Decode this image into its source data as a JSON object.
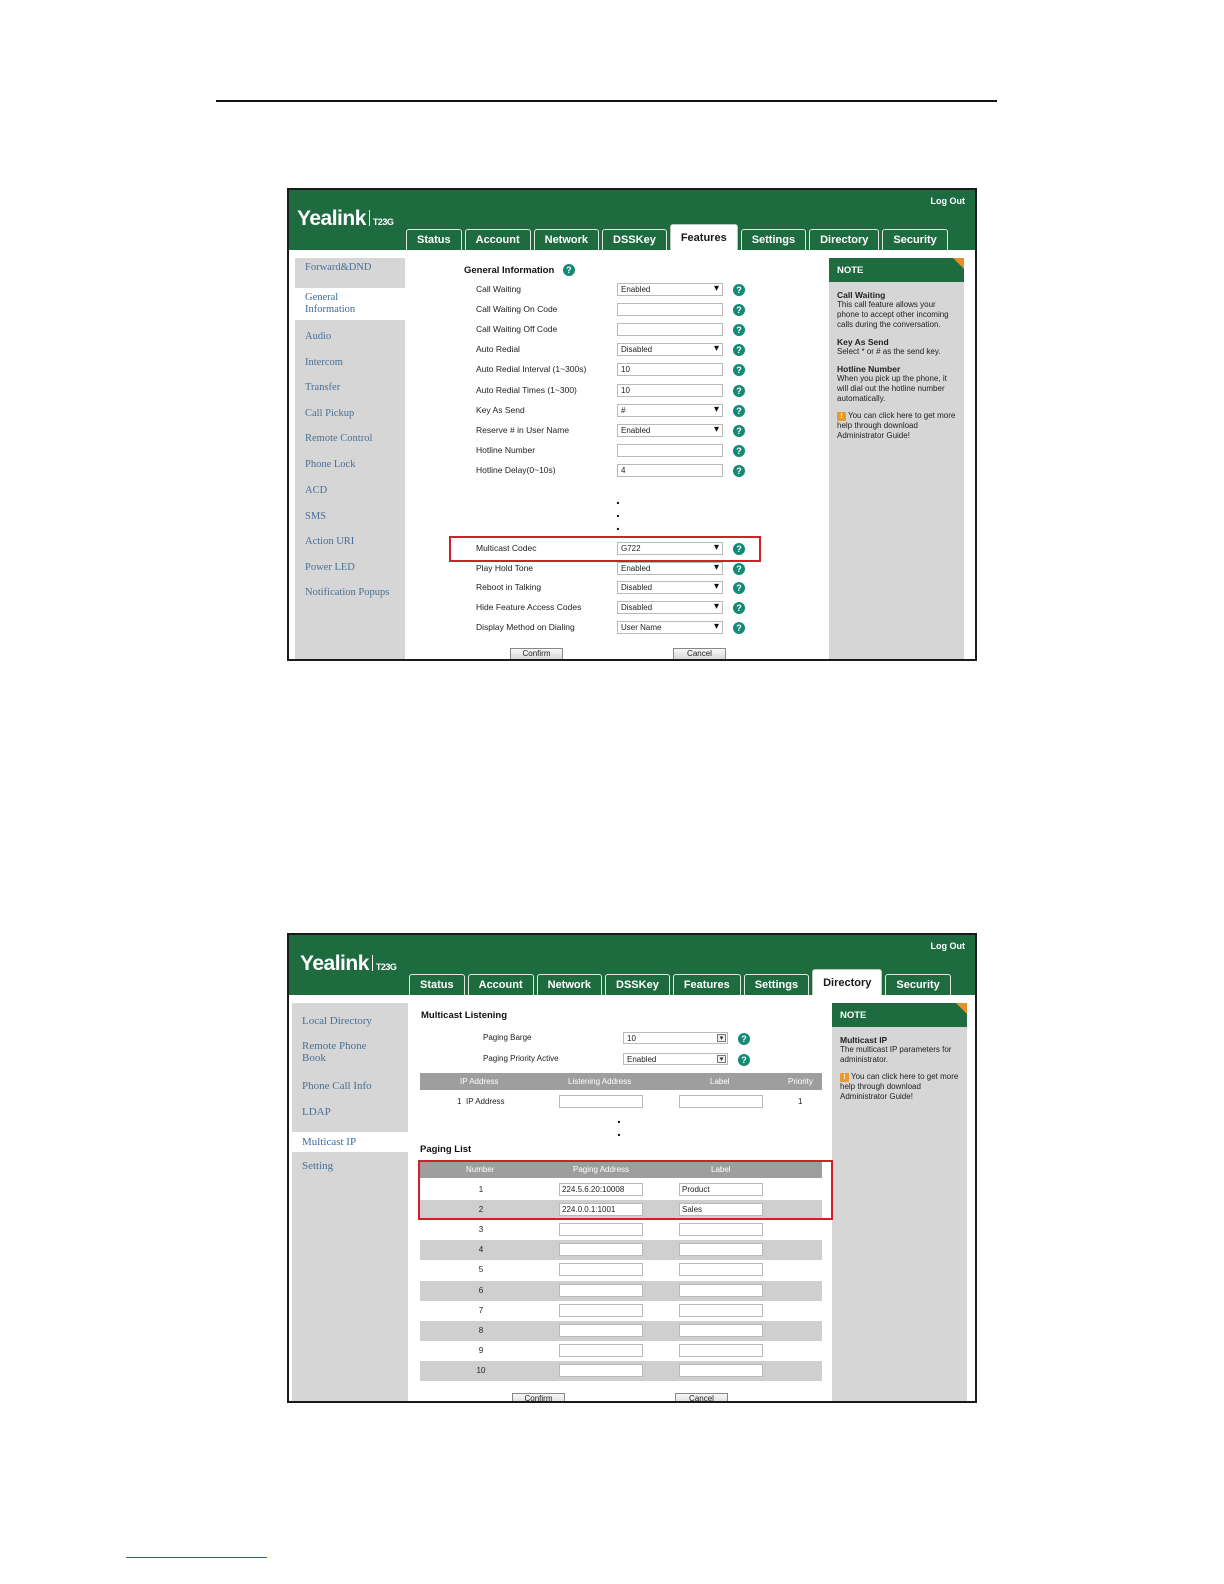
{
  "brand": {
    "name": "Yealink",
    "model": "T23G"
  },
  "screen1": {
    "logout": "Log Out",
    "tabs": [
      "Status",
      "Account",
      "Network",
      "DSSKey",
      "Features",
      "Settings",
      "Directory",
      "Security"
    ],
    "active_tab": "Features",
    "sidebar": [
      "Forward&DND",
      "General Information",
      "Audio",
      "Intercom",
      "Transfer",
      "Call Pickup",
      "Remote Control",
      "Phone Lock",
      "ACD",
      "SMS",
      "Action URI",
      "Power LED",
      "Notification Popups"
    ],
    "section_title": "General Information",
    "fields": [
      {
        "label": "Call Waiting",
        "value": "Enabled",
        "type": "select"
      },
      {
        "label": "Call Waiting On Code",
        "value": "",
        "type": "input"
      },
      {
        "label": "Call Waiting Off Code",
        "value": "",
        "type": "input"
      },
      {
        "label": "Auto Redial",
        "value": "Disabled",
        "type": "select"
      },
      {
        "label": "Auto Redial Interval (1~300s)",
        "value": "10",
        "type": "input"
      },
      {
        "label": "Auto Redial Times (1~300)",
        "value": "10",
        "type": "input"
      },
      {
        "label": "Key As Send",
        "value": "#",
        "type": "select"
      },
      {
        "label": "Reserve # in User Name",
        "value": "Enabled",
        "type": "select"
      },
      {
        "label": "Hotline Number",
        "value": "",
        "type": "input"
      },
      {
        "label": "Hotline Delay(0~10s)",
        "value": "4",
        "type": "input"
      }
    ],
    "fields_after": [
      {
        "label": "Multicast Codec",
        "value": "G722",
        "type": "select"
      },
      {
        "label": "Play Hold Tone",
        "value": "Enabled",
        "type": "select"
      },
      {
        "label": "Reboot in Talking",
        "value": "Disabled",
        "type": "select"
      },
      {
        "label": "Hide Feature Access Codes",
        "value": "Disabled",
        "type": "select"
      },
      {
        "label": "Display Method on Dialing",
        "value": "User Name",
        "type": "select"
      }
    ],
    "confirm": "Confirm",
    "cancel": "Cancel",
    "note": {
      "title": "NOTE",
      "items": [
        {
          "head": "Call Waiting",
          "text": "This call feature allows your phone to accept other incoming calls during the conversation."
        },
        {
          "head": "Key As Send",
          "text": "Select * or # as the send key."
        },
        {
          "head": "Hotline Number",
          "text": "When you pick up the phone, it will dial out the hotline number automatically."
        }
      ],
      "help": "You can click here to get more help through download Administrator Guide!"
    }
  },
  "screen2": {
    "logout": "Log Out",
    "tabs": [
      "Status",
      "Account",
      "Network",
      "DSSKey",
      "Features",
      "Settings",
      "Directory",
      "Security"
    ],
    "active_tab": "Directory",
    "sidebar": [
      "Local Directory",
      "Remote Phone Book",
      "Phone Call Info",
      "LDAP",
      "Multicast IP",
      "Setting"
    ],
    "listening_title": "Multicast Listening",
    "paging_barge_label": "Paging Barge",
    "paging_barge_value": "10",
    "paging_priority_label": "Paging Priority Active",
    "paging_priority_value": "Enabled",
    "listen_headers": [
      "IP Address",
      "Listening Address",
      "Label",
      "Priority"
    ],
    "listen_row": {
      "num": "1",
      "name": "IP Address",
      "priority": "1"
    },
    "paging_title": "Paging List",
    "paging_headers": [
      "Number",
      "Paging Address",
      "Label"
    ],
    "paging_rows": [
      {
        "num": "1",
        "addr": "224.5.6.20:10008",
        "label": "Product"
      },
      {
        "num": "2",
        "addr": "224.0.0.1:1001",
        "label": "Sales"
      },
      {
        "num": "3",
        "addr": "",
        "label": ""
      },
      {
        "num": "4",
        "addr": "",
        "label": ""
      },
      {
        "num": "5",
        "addr": "",
        "label": ""
      },
      {
        "num": "6",
        "addr": "",
        "label": ""
      },
      {
        "num": "7",
        "addr": "",
        "label": ""
      },
      {
        "num": "8",
        "addr": "",
        "label": ""
      },
      {
        "num": "9",
        "addr": "",
        "label": ""
      },
      {
        "num": "10",
        "addr": "",
        "label": ""
      }
    ],
    "confirm": "Confirm",
    "cancel": "Cancel",
    "note": {
      "title": "NOTE",
      "items": [
        {
          "head": "Multicast IP",
          "text": "The multicast IP parameters for administrator."
        }
      ],
      "help": "You can click here to get more help through download Administrator Guide!"
    }
  }
}
